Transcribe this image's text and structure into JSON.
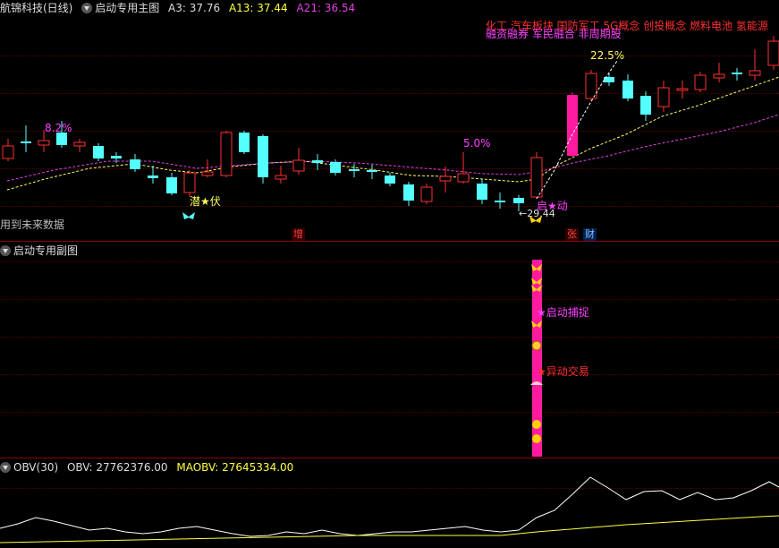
{
  "main_header": {
    "stock": "航锦科技(日线)",
    "indicator": "启动专用主图",
    "a3": "A3: 37.76",
    "a13": "A13: 37.44",
    "a21": "A21: 36.54"
  },
  "sub_header": {
    "indicator": "启动专用副图"
  },
  "obv_header": {
    "name": "OBV(30)",
    "obv": "OBV: 27762376.00",
    "maobv": "MAOBV: 27645334.00"
  },
  "main_labels": {
    "pct1": "8.2%",
    "pct2": "5.0%",
    "pct3": "22.5%",
    "qianfu": "潜★伏",
    "qidong": "启★动",
    "low_price": "←29.44",
    "future_note": "用到未来数据",
    "concepts": "化工    汽车板块 国防军工 5G概念 创投概念 燃料电池 氢能源",
    "margin_info": "融资融券 军民融合 非周期股",
    "tag_zeng": "增",
    "tag_zhang": "张",
    "tag_cai": "财"
  },
  "sub_labels": {
    "capture": "★启动捕捉",
    "abnormal": "★异动交易"
  },
  "colors": {
    "bg": "#000000",
    "separator": "#8b0000",
    "up_candle": "#ff3030",
    "down_candle": "#54ffff",
    "ma_yellow": "#ffff60",
    "ma_magenta": "#e040e0",
    "obv_line": "#ffffff",
    "maobv_line": "#ffff40",
    "signal_bar": "#ff1aa0"
  },
  "icons": [
    "expand-triangle-icon",
    "butterfly-icon",
    "moneybag-icon",
    "umbrella-icon",
    "ingot-icon"
  ]
}
